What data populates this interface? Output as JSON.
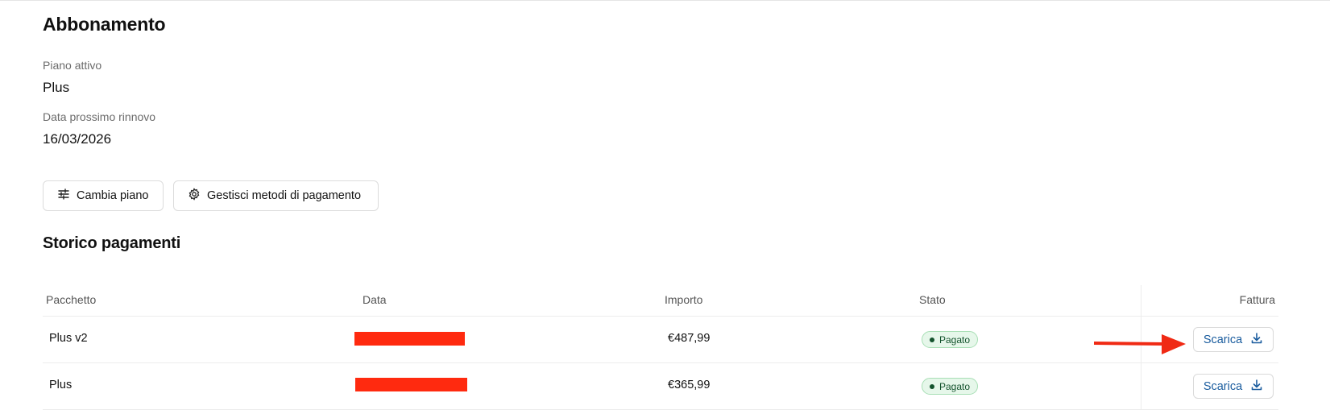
{
  "subscription": {
    "title": "Abbonamento",
    "plan_label": "Piano attivo",
    "plan_value": "Plus",
    "renewal_label": "Data prossimo rinnovo",
    "renewal_value": "16/03/2026",
    "change_plan_label": "Cambia piano",
    "manage_payment_label": "Gestisci metodi di pagamento"
  },
  "payments": {
    "title": "Storico pagamenti",
    "columns": [
      "Pacchetto",
      "Data",
      "Importo",
      "Stato",
      "Fattura"
    ],
    "rows": [
      {
        "package": "Plus v2",
        "date": "",
        "amount": "€487,99",
        "status": "Pagato",
        "invoice_label": "Scarica"
      },
      {
        "package": "Plus",
        "date": "",
        "amount": "€365,99",
        "status": "Pagato",
        "invoice_label": "Scarica"
      }
    ]
  },
  "colors": {
    "redaction": "#ff2a0f",
    "badge_bg": "#e6f7ea",
    "link_blue": "#1a5c9e",
    "annotation_arrow": "#f02a14"
  },
  "icons": {
    "change_plan": "sliders-icon",
    "manage_payment": "gear-icon",
    "download": "download-icon"
  }
}
